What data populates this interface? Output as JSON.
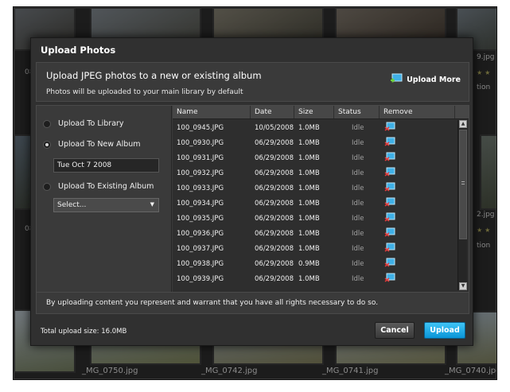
{
  "background": {
    "left_text": [
      "08",
      "08"
    ],
    "right_text": [
      "9.jpg",
      "tion",
      "2.jpg",
      "tion"
    ],
    "thumbnail_names": [
      "_MG_0750.jpg",
      "_MG_0742.jpg",
      "_MG_0741.jpg",
      "_MG_0740.jpg"
    ]
  },
  "dialog": {
    "title": "Upload Photos",
    "header": {
      "main_text": "Upload JPEG photos to a new or existing album",
      "sub_text": "Photos will be uploaded to your main library by default",
      "upload_more_label": "Upload More"
    },
    "options": {
      "upload_to_library": "Upload To Library",
      "upload_to_new_album": "Upload To New Album",
      "new_album_value": "Tue Oct 7 2008",
      "upload_to_existing_album": "Upload To Existing Album",
      "select_value": "Select..."
    },
    "table": {
      "columns": [
        "Name",
        "Date",
        "Size",
        "Status",
        "Remove"
      ],
      "rows": [
        {
          "name": "100_0945.JPG",
          "date": "10/05/2008",
          "size": "1.0MB",
          "status": "Idle"
        },
        {
          "name": "100_0930.JPG",
          "date": "06/29/2008",
          "size": "1.0MB",
          "status": "Idle"
        },
        {
          "name": "100_0931.JPG",
          "date": "06/29/2008",
          "size": "1.0MB",
          "status": "Idle"
        },
        {
          "name": "100_0932.JPG",
          "date": "06/29/2008",
          "size": "1.0MB",
          "status": "Idle"
        },
        {
          "name": "100_0933.JPG",
          "date": "06/29/2008",
          "size": "1.0MB",
          "status": "Idle"
        },
        {
          "name": "100_0934.JPG",
          "date": "06/29/2008",
          "size": "1.0MB",
          "status": "Idle"
        },
        {
          "name": "100_0935.JPG",
          "date": "06/29/2008",
          "size": "1.0MB",
          "status": "Idle"
        },
        {
          "name": "100_0936.JPG",
          "date": "06/29/2008",
          "size": "1.0MB",
          "status": "Idle"
        },
        {
          "name": "100_0937.JPG",
          "date": "06/29/2008",
          "size": "1.0MB",
          "status": "Idle"
        },
        {
          "name": "100_0938.JPG",
          "date": "06/29/2008",
          "size": "0.9MB",
          "status": "Idle"
        },
        {
          "name": "100_0939.JPG",
          "date": "06/29/2008",
          "size": "1.0MB",
          "status": "Idle"
        }
      ]
    },
    "rights_text": "By uploading content you represent and warrant that you have all rights necessary to do so.",
    "total_upload_size": "Total upload size: 16.0MB",
    "cancel_label": "Cancel",
    "upload_label": "Upload"
  },
  "colors": {
    "accent": "#16a8e8",
    "dialog_bg": "#303030",
    "panel_bg": "#3a3a3a"
  }
}
